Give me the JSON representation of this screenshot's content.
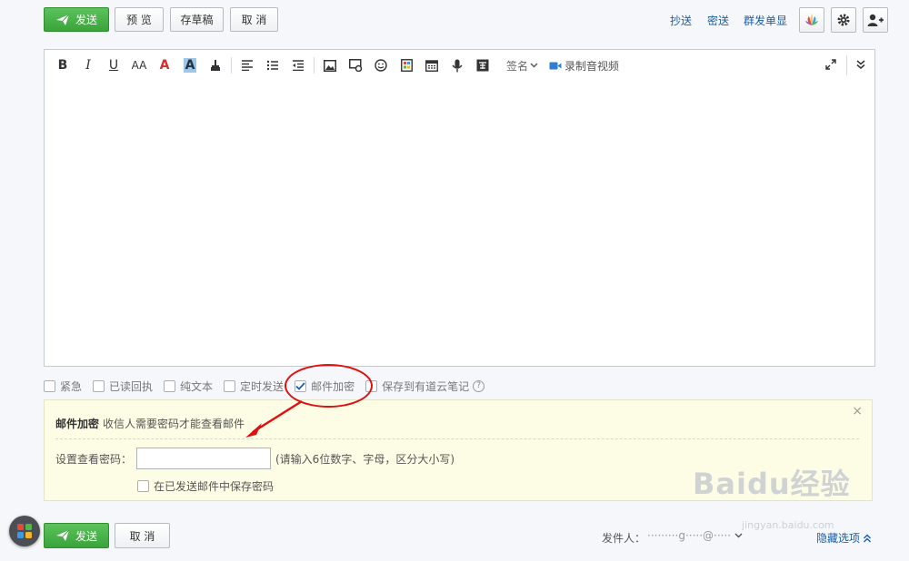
{
  "colors": {
    "send_green": "#3aa33a",
    "link_blue": "#1a5ea8",
    "panel_yellow": "#fdfde6",
    "annotation_red": "#e01010"
  },
  "top_bar": {
    "send_label": "发送",
    "preview_label": "预 览",
    "draft_label": "存草稿",
    "cancel_label": "取 消",
    "cc_link": "抄送",
    "bcc_link": "密送",
    "separate_send_link": "群发单显"
  },
  "toolbar": {
    "bold": "B",
    "italic": "I",
    "underline": "U",
    "font_size": "AA",
    "font_color": "A",
    "bg_color": "A",
    "signature_label": "签名",
    "record_video_label": "录制音视频"
  },
  "options": {
    "urgent": "紧急",
    "read_receipt": "已读回执",
    "plain_text": "纯文本",
    "scheduled": "定时发送",
    "encrypt": "邮件加密",
    "save_to_notes": "保存到有道云笔记",
    "help": "?"
  },
  "encrypt_panel": {
    "title": "邮件加密",
    "subtitle": "收信人需要密码才能查看邮件",
    "close": "×",
    "password_label": "设置查看密码：",
    "password_value": "",
    "password_hint": "(请输入6位数字、字母，区分大小写)",
    "save_password_label": "在已发送邮件中保存密码"
  },
  "bottom_bar": {
    "send_label": "发送",
    "cancel_label": "取 消",
    "sender_label": "发件人：",
    "sender_value": "·········g·····@·····",
    "hide_options": "隐藏选项"
  },
  "watermark": {
    "text": "Baidu经验",
    "sub": "jingyan.baidu.com"
  }
}
